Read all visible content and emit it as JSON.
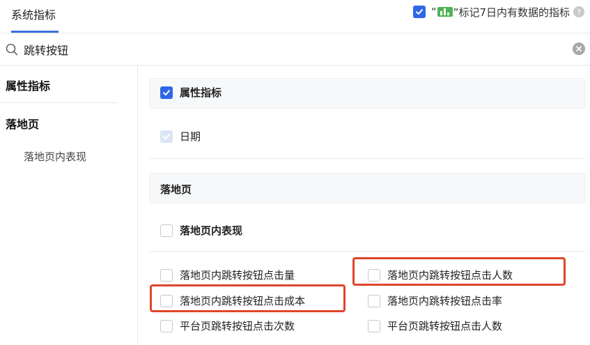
{
  "header": {
    "tab_label": "系统指标",
    "mark_prefix": "“",
    "mark_suffix": "”标记7日内有数据的指标",
    "mark_checked": true,
    "help_glyph": "?"
  },
  "search": {
    "value": "跳转按钮",
    "placeholder": ""
  },
  "sidebar": {
    "groups": [
      {
        "label": "属性指标"
      },
      {
        "label": "落地页",
        "items": [
          {
            "label": "落地页内表现"
          }
        ]
      }
    ]
  },
  "content": {
    "attr_group": {
      "title": "属性指标",
      "checked": true,
      "items": [
        {
          "label": "日期",
          "state": "checked-disabled"
        }
      ]
    },
    "landing_group": {
      "title": "落地页",
      "subgroup": {
        "title": "落地页内表现",
        "checked": false
      },
      "metrics": [
        {
          "label": "落地页内跳转按钮点击量",
          "checked": false
        },
        {
          "label": "落地页内跳转按钮点击人数",
          "checked": false
        },
        {
          "label": "落地页内跳转按钮点击成本",
          "checked": false
        },
        {
          "label": "落地页内跳转按钮点击率",
          "checked": false
        },
        {
          "label": "平台页跳转按钮点击次数",
          "checked": false
        },
        {
          "label": "平台页跳转按钮点击人数",
          "checked": false
        }
      ]
    }
  },
  "colors": {
    "accent": "#2f68e6",
    "highlight": "#e0452a",
    "bar_icon": "#4fb356"
  },
  "icons": {
    "search": "search-icon",
    "clear": "clear-icon",
    "chart": "bar-chart-icon",
    "help": "help-icon"
  }
}
